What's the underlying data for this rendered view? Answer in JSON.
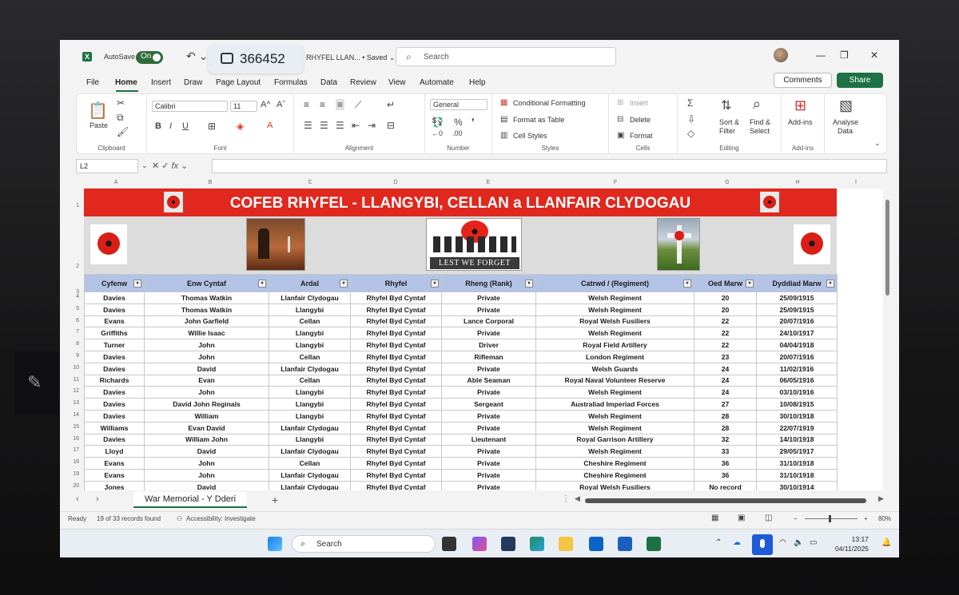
{
  "titlebar": {
    "autosave_label": "AutoSave",
    "autosave_state": "On",
    "overlay_number": "366452",
    "doc_title": "RHYFEL LLAN...",
    "saved_status": "• Saved",
    "search_placeholder": "Search"
  },
  "menu": {
    "items": [
      "File",
      "Home",
      "Insert",
      "Draw",
      "Page Layout",
      "Formulas",
      "Data",
      "Review",
      "View",
      "Automate",
      "Help"
    ],
    "active": "Home",
    "comments_label": "Comments",
    "share_label": "Share"
  },
  "ribbon": {
    "clipboard": {
      "label": "Clipboard",
      "paste": "Paste"
    },
    "font": {
      "label": "Font",
      "family": "Calibri",
      "size": "11"
    },
    "alignment": {
      "label": "Alignment"
    },
    "number": {
      "label": "Number",
      "format": "General"
    },
    "styles": {
      "label": "Styles",
      "conditional": "Conditional Formatting",
      "format_table": "Format as Table",
      "cell_styles": "Cell Styles"
    },
    "cells": {
      "label": "Cells",
      "insert": "Insert",
      "delete": "Delete",
      "format": "Format"
    },
    "editing": {
      "label": "Editing",
      "sort": "Sort &",
      "filter": "Filter",
      "find": "Find &",
      "select": "Select"
    },
    "addins": {
      "label": "Add-ins",
      "addins": "Add-ins"
    },
    "analyse": {
      "line1": "Analyse",
      "line2": "Data"
    }
  },
  "formula_bar": {
    "name_box": "L2",
    "fx": "fx",
    "value": ""
  },
  "columns": [
    "A",
    "B",
    "C",
    "D",
    "E",
    "F",
    "G",
    "H",
    "I"
  ],
  "sheet": {
    "banner_title": "COFEB RHYFEL - LLANGYBI, CELLAN a LLANFAIR CLYDOGAU",
    "lest_we_forget": "LEST WE FORGET",
    "headers": [
      "Cyfenw",
      "Enw Cyntaf",
      "Ardal",
      "Rhyfel",
      "Rheng (Rank)",
      "Catrwd / (Regiment)",
      "Oed Marw",
      "Dyddiad Marw"
    ],
    "rows": [
      {
        "n": "4",
        "c": [
          "Davies",
          "Thomas Watkin",
          "Llanfair Clydogau",
          "Rhyfel Byd Cyntaf",
          "Private",
          "Welsh Regiment",
          "20",
          "25/09/1915"
        ]
      },
      {
        "n": "5",
        "c": [
          "Davies",
          "Thomas Watkin",
          "Llangybi",
          "Rhyfel Byd Cyntaf",
          "Private",
          "Welsh Regiment",
          "20",
          "25/09/1915"
        ]
      },
      {
        "n": "6",
        "c": [
          "Evans",
          "John Garfield",
          "Cellan",
          "Rhyfel Byd Cyntaf",
          "Lance Corporal",
          "Royal Welsh Fusiliers",
          "22",
          "20/07/1916"
        ]
      },
      {
        "n": "7",
        "c": [
          "Griffiths",
          "Willie Isaac",
          "Llangybi",
          "Rhyfel Byd Cyntaf",
          "Private",
          "Welsh Regiment",
          "22",
          "24/10/1917"
        ]
      },
      {
        "n": "8",
        "c": [
          "Turner",
          "John",
          "Llangybi",
          "Rhyfel Byd Cyntaf",
          "Driver",
          "Royal Field Artillery",
          "22",
          "04/04/1918"
        ]
      },
      {
        "n": "9",
        "c": [
          "Davies",
          "John",
          "Cellan",
          "Rhyfel Byd Cyntaf",
          "Rifleman",
          "London Regiment",
          "23",
          "20/07/1916"
        ]
      },
      {
        "n": "10",
        "c": [
          "Davies",
          "David",
          "Llanfair Clydogau",
          "Rhyfel Byd Cyntaf",
          "Private",
          "Welsh Guards",
          "24",
          "11/02/1916"
        ]
      },
      {
        "n": "11",
        "c": [
          "Richards",
          "Evan",
          "Cellan",
          "Rhyfel Byd Cyntaf",
          "Able Seaman",
          "Royal Naval Volunteer Reserve",
          "24",
          "06/05/1916"
        ]
      },
      {
        "n": "12",
        "c": [
          "Davies",
          "John",
          "Llangybi",
          "Rhyfel Byd Cyntaf",
          "Private",
          "Welsh Regiment",
          "24",
          "03/10/1916"
        ]
      },
      {
        "n": "13",
        "c": [
          "Davies",
          "David John Reginals",
          "Llangybi",
          "Rhyfel Byd Cyntaf",
          "Sergeant",
          "Australiad Imperiad Forces",
          "27",
          "10/08/1915"
        ]
      },
      {
        "n": "14",
        "c": [
          "Davies",
          "William",
          "Llangybi",
          "Rhyfel Byd Cyntaf",
          "Private",
          "Welsh Regiment",
          "28",
          "30/10/1918"
        ]
      },
      {
        "n": "15",
        "c": [
          "Williams",
          "Evan David",
          "Llanfair Clydogau",
          "Rhyfel Byd Cyntaf",
          "Private",
          "Welsh Regiment",
          "28",
          "22/07/1919"
        ]
      },
      {
        "n": "16",
        "c": [
          "Davies",
          "William John",
          "Llangybi",
          "Rhyfel Byd Cyntaf",
          "Lieutenant",
          "Royal Garrison Artillery",
          "32",
          "14/10/1918"
        ]
      },
      {
        "n": "17",
        "c": [
          "Lloyd",
          "David",
          "Llanfair Clydogau",
          "Rhyfel Byd Cyntaf",
          "Private",
          "Welsh Regiment",
          "33",
          "29/05/1917"
        ]
      },
      {
        "n": "18",
        "c": [
          "Evans",
          "John",
          "Cellan",
          "Rhyfel Byd Cyntaf",
          "Private",
          "Cheshire Regiment",
          "36",
          "31/10/1918"
        ]
      },
      {
        "n": "19",
        "c": [
          "Evans",
          "John",
          "Llanfair Clydogau",
          "Rhyfel Byd Cyntaf",
          "Private",
          "Cheshire Regiment",
          "36",
          "31/10/1918"
        ]
      },
      {
        "n": "20",
        "c": [
          "Jones",
          "David",
          "Llanfair Clydogau",
          "Rhyfel Byd Cyntaf",
          "Private",
          "Royal Welsh Fusiliers",
          "No record",
          "30/10/1914"
        ]
      }
    ]
  },
  "sheet_tab": "War Memorial  - Y Dderi",
  "status": {
    "ready": "Ready",
    "records": "19 of 33 records found",
    "accessibility": "Accessibility: Investigate",
    "zoom": "80%"
  },
  "taskbar": {
    "search_label": "Search",
    "time": "13:17",
    "date": "04/11/2025"
  },
  "colors": {
    "excel_green": "#1d7145",
    "banner_red": "#e0281e",
    "header_blue": "#b3c3e6"
  }
}
